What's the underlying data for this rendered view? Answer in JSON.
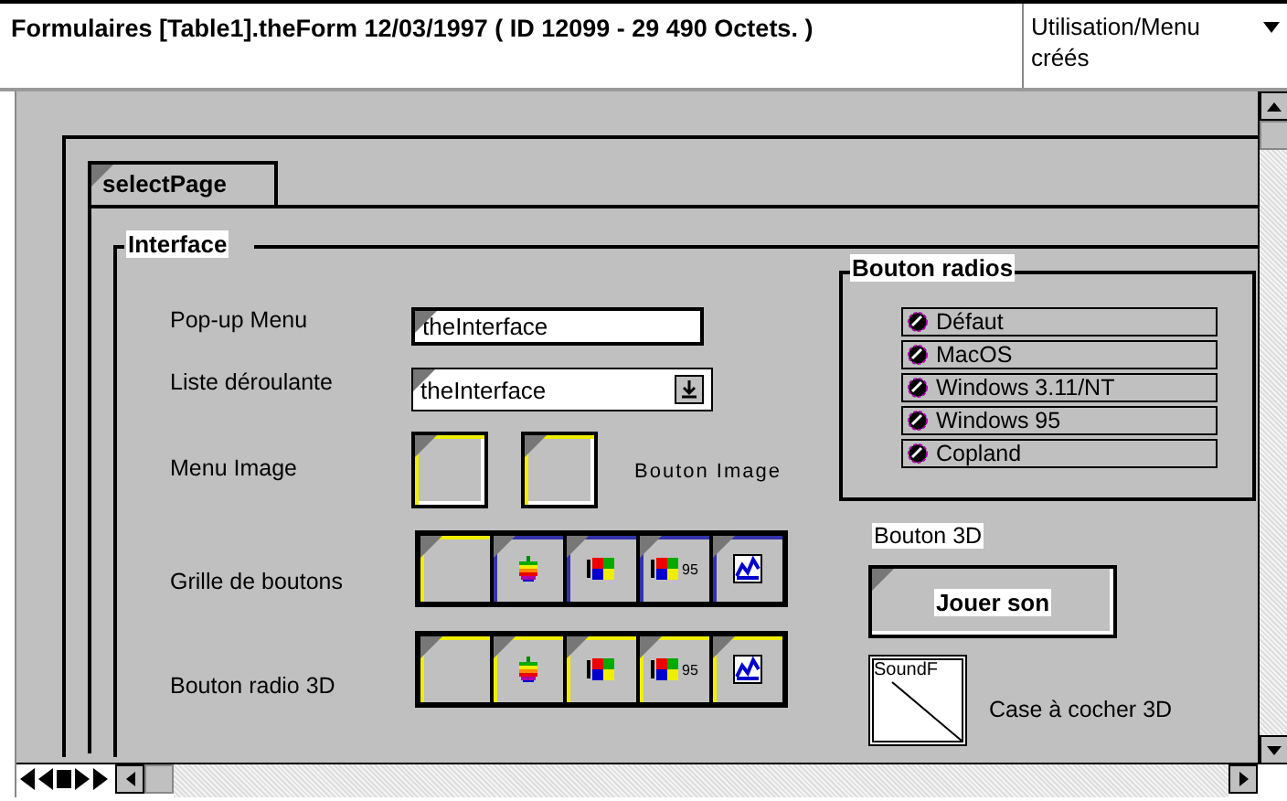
{
  "header": {
    "title": "Formulaires [Table1].theForm  12/03/1997 (  ID 12099 - 29 490 Octets. )",
    "menu_line1": "Utilisation/Menu",
    "menu_line2": "créés"
  },
  "tab": {
    "label": "selectPage"
  },
  "group": {
    "label": "Interface"
  },
  "rows": [
    {
      "kind": "popup",
      "label": "Pop-up Menu",
      "value": "theInterface"
    },
    {
      "kind": "dropdown",
      "label": "Liste déroulante",
      "value": "theInterface"
    },
    {
      "kind": "image",
      "label": "Menu Image",
      "caption": "Bouton Image"
    },
    {
      "kind": "grid",
      "label": "Grille de boutons",
      "cells": [
        {
          "kind": "blank"
        },
        {
          "kind": "apple"
        },
        {
          "kind": "flag"
        },
        {
          "kind": "flag",
          "text": "95"
        },
        {
          "kind": "chart"
        }
      ]
    },
    {
      "kind": "grid3d",
      "label": "Bouton radio 3D",
      "cells": [
        {
          "kind": "blank"
        },
        {
          "kind": "apple"
        },
        {
          "kind": "flag"
        },
        {
          "kind": "flag",
          "text": "95"
        },
        {
          "kind": "chart"
        }
      ]
    }
  ],
  "radios": {
    "title": "Bouton radios",
    "items": [
      {
        "label": "Défaut",
        "selected": false
      },
      {
        "label": "MacOS",
        "selected": false
      },
      {
        "label": "Windows 3.11/NT",
        "selected": false
      },
      {
        "label": "Windows 95",
        "selected": false
      },
      {
        "label": "Copland",
        "selected": false
      }
    ]
  },
  "button3d": {
    "label": "Bouton 3D",
    "button": "Jouer son"
  },
  "checkbox3d": {
    "picture": "SoundF",
    "label": "Case à cocher 3D",
    "checked": false
  }
}
